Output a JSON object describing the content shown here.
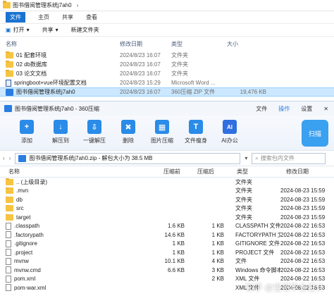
{
  "explorer": {
    "title": "图书借阅管理系统j7ah0",
    "menu": [
      "文件",
      "主页",
      "共享",
      "查看"
    ],
    "toolbar": {
      "open": "打开",
      "share": "共享",
      "new_folder": "新建文件夹"
    },
    "columns": [
      "名称",
      "修改日期",
      "类型",
      "大小"
    ],
    "rows": [
      {
        "name": "01 配套环境",
        "date": "2024/8/23 16:07",
        "type": "文件夹",
        "size": ""
      },
      {
        "name": "02 db数据库",
        "date": "2024/8/23 16:07",
        "type": "文件夹",
        "size": ""
      },
      {
        "name": "03 论文文档",
        "date": "2024/8/23 16:07",
        "type": "文件夹",
        "size": ""
      },
      {
        "name": "springboot+vue环境配置文档",
        "date": "2024/8/23 15:29",
        "type": "Microsoft Word ...",
        "size": ""
      },
      {
        "name": "图书借阅管理系统j7ah0",
        "date": "2024/8/23 16:07",
        "type": "360压缩 ZIP 文件",
        "size": "19,476 KB"
      }
    ]
  },
  "zip": {
    "title": "图书借阅管理系统j7ah0 - 360压缩",
    "title_menu": [
      "文件",
      "操作",
      "设置"
    ],
    "tools": [
      "添加",
      "解压到",
      "一键解压",
      "删除",
      "图片压缩",
      "文件瘦身",
      "AI办公"
    ],
    "scan_label": "扫描",
    "address": "图书借阅管理系统j7ah0.zip - 解包大小为 38.5 MB",
    "search_placeholder": "搜索包内文件",
    "columns": [
      "名称",
      "压缩前",
      "压缩后",
      "类型",
      "修改日期"
    ],
    "rows": [
      {
        "name": ".. (上级目录)",
        "before": "",
        "after": "",
        "type": "文件夹",
        "date": "",
        "icon": "folder"
      },
      {
        "name": ".mvn",
        "before": "",
        "after": "",
        "type": "文件夹",
        "date": "2024-08-23 15:59",
        "icon": "folder"
      },
      {
        "name": "db",
        "before": "",
        "after": "",
        "type": "文件夹",
        "date": "2024-08-23 15:59",
        "icon": "folder"
      },
      {
        "name": "src",
        "before": "",
        "after": "",
        "type": "文件夹",
        "date": "2024-08-23 15:59",
        "icon": "folder"
      },
      {
        "name": "target",
        "before": "",
        "after": "",
        "type": "文件夹",
        "date": "2024-08-23 15:59",
        "icon": "folder"
      },
      {
        "name": ".classpath",
        "before": "1.6 KB",
        "after": "1 KB",
        "type": "CLASSPATH 文件",
        "date": "2024-08-22 16:53",
        "icon": "doc"
      },
      {
        "name": ".factorypath",
        "before": "14.6 KB",
        "after": "1 KB",
        "type": "FACTORYPATH 文件",
        "date": "2024-08-22 16:53",
        "icon": "doc"
      },
      {
        "name": ".gitignore",
        "before": "1 KB",
        "after": "1 KB",
        "type": "GITIGNORE 文件",
        "date": "2024-08-22 16:53",
        "icon": "doc"
      },
      {
        "name": ".project",
        "before": "1 KB",
        "after": "1 KB",
        "type": "PROJECT 文件",
        "date": "2024-08-22 16:53",
        "icon": "doc"
      },
      {
        "name": "mvnw",
        "before": "10.1 KB",
        "after": "4 KB",
        "type": "文件",
        "date": "2024-08-22 16:53",
        "icon": "doc"
      },
      {
        "name": "mvnw.cmd",
        "before": "6.6 KB",
        "after": "3 KB",
        "type": "Windows 命令脚本",
        "date": "2024-08-22 16:53",
        "icon": "doc"
      },
      {
        "name": "pom.xml",
        "before": "",
        "after": "2 KB",
        "type": "XML 文件",
        "date": "2024-08-22 16:53",
        "icon": "doc"
      },
      {
        "name": "pom-war.xml",
        "before": "",
        "after": "",
        "type": "XML 文件",
        "date": "2024-08-22 16:53",
        "icon": "doc"
      }
    ],
    "watermark": "知乎 @宝哥毕业设计"
  }
}
